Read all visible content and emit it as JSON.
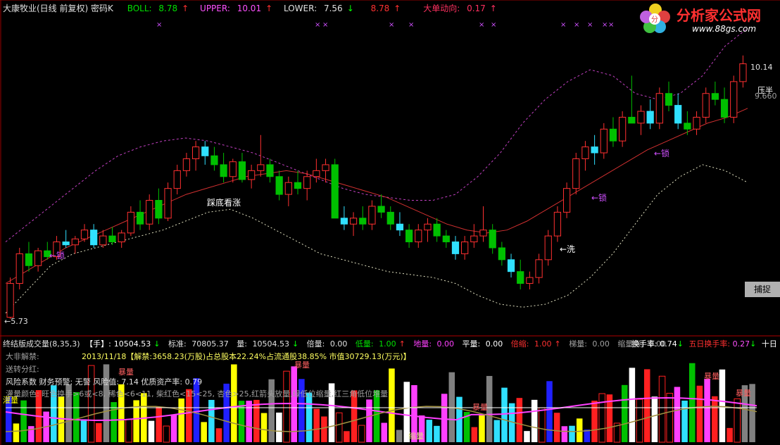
{
  "main_header": {
    "stock_title": "大康牧业(日线 前复权) 密码K",
    "boll_label": "BOLL:",
    "boll_value": "8.78",
    "boll_arrow": "↑",
    "upper_label": "UPPER:",
    "upper_value": "10.01",
    "upper_arrow": "↑",
    "lower_label": "LOWER:",
    "lower_value": "7.56",
    "lower_arrow": "↓",
    "extra_value": "8.78",
    "extra_arrow": "↑",
    "bigorder_label": "大单动向:",
    "bigorder_value": "0.17",
    "bigorder_arrow": "↑"
  },
  "logo": {
    "title": "分析家公式网",
    "url": "www.88gs.com"
  },
  "price_labels": {
    "high": "10.14",
    "mid": "9.660",
    "low": "5.73",
    "low_prefix": "←",
    "right_tag": "压半"
  },
  "annotations": {
    "pattern1": "踩底看涨",
    "lock1": "←锁",
    "lock2": "←锁",
    "lock3": "←锁",
    "wash": "←洗",
    "xmark": "×"
  },
  "capture_button": "捕捉",
  "volume_header": {
    "title": "终结版成交量(8,35,3)",
    "hand_label": "【手】:",
    "hand_value": "10504.53",
    "hand_arrow": "↓",
    "std_label": "标准:",
    "std_value": "70805.37",
    "vol_label": "量:",
    "vol_value": "10504.53",
    "vol_arrow": "↓",
    "bei_label": "倍量:",
    "bei_value": "0.00",
    "low_label": "低量:",
    "low_value": "1.00",
    "low_arrow": "↑",
    "di_label": "地量:",
    "di_value": "0.00",
    "ping_label": "平量:",
    "ping_value": "0.00",
    "beisuo_label": "倍缩:",
    "beisuo_value": "1.00",
    "beisuo_arrow": "↑",
    "ti_label": "梯量:",
    "ti_value": "0.00",
    "suozhang_label": "缩量涨:",
    "suozhang_value": "0.00",
    "turnover_label": "换手率:",
    "turnover_value": "0.74",
    "turnover_arrow": "↓",
    "five_label": "五日换手率:",
    "five_value": "0.27",
    "five_arrow": "↓",
    "ten_label": "十日"
  },
  "info_lines": {
    "unlock_title": "大非解禁:",
    "unlock_text": "2013/11/18【解禁:3658.23(万股)占总股本22.24%占流通股38.85% 市值30729.13(万元)】",
    "dividend": "送转分红:",
    "risk": "风险系数 财务预警: 无警   风险值: 7.14   优质资产率: 0.79",
    "note": "灌量颜色: 旺色换手>6或<8, 稀色<6<11, 柴红色<15<25, 杏色>25,红箭头放量,绿低位缩量,红三角低位堆量"
  },
  "volume_marks": {
    "burst": "暴量",
    "shrink": "缩量",
    "fill": "灌量"
  },
  "chart_data": {
    "type": "candlestick",
    "price_range": [
      5.5,
      10.6
    ],
    "candles": [
      [
        5.73,
        6.4,
        5.7,
        6.3
      ],
      [
        6.3,
        6.9,
        6.2,
        6.8
      ],
      [
        6.8,
        7.0,
        6.5,
        6.6
      ],
      [
        6.6,
        6.9,
        6.5,
        6.85
      ],
      [
        6.85,
        7.0,
        6.7,
        6.75
      ],
      [
        6.75,
        7.1,
        6.7,
        7.0
      ],
      [
        7.0,
        7.2,
        6.9,
        6.95
      ],
      [
        6.95,
        7.1,
        6.8,
        7.05
      ],
      [
        7.05,
        7.3,
        7.0,
        7.2
      ],
      [
        7.2,
        7.3,
        6.9,
        6.95
      ],
      [
        6.95,
        7.2,
        6.9,
        7.1
      ],
      [
        7.1,
        7.25,
        6.95,
        7.0
      ],
      [
        7.0,
        7.2,
        6.9,
        7.15
      ],
      [
        7.15,
        7.6,
        7.1,
        7.5
      ],
      [
        7.5,
        7.7,
        7.2,
        7.3
      ],
      [
        7.3,
        7.8,
        7.2,
        7.7
      ],
      [
        7.7,
        7.9,
        7.3,
        7.4
      ],
      [
        7.4,
        8.0,
        7.35,
        7.9
      ],
      [
        7.9,
        8.3,
        7.8,
        8.2
      ],
      [
        8.2,
        8.5,
        8.1,
        8.4
      ],
      [
        8.4,
        8.7,
        8.2,
        8.6
      ],
      [
        8.6,
        8.7,
        8.3,
        8.45
      ],
      [
        8.45,
        8.6,
        8.2,
        8.3
      ],
      [
        8.3,
        8.5,
        8.0,
        8.1
      ],
      [
        8.1,
        8.4,
        8.0,
        8.35
      ],
      [
        8.35,
        8.5,
        8.0,
        8.05
      ],
      [
        8.05,
        8.3,
        7.9,
        8.2
      ],
      [
        8.2,
        8.8,
        8.1,
        8.3
      ],
      [
        8.3,
        8.4,
        8.0,
        8.1
      ],
      [
        8.1,
        8.2,
        7.7,
        7.8
      ],
      [
        7.8,
        8.1,
        7.6,
        8.0
      ],
      [
        8.0,
        8.2,
        7.8,
        7.9
      ],
      [
        7.9,
        8.2,
        7.7,
        8.1
      ],
      [
        8.1,
        8.4,
        8.0,
        8.2
      ],
      [
        8.2,
        8.4,
        8.0,
        8.3
      ],
      [
        8.3,
        8.4,
        7.6,
        7.4
      ],
      [
        7.4,
        7.6,
        7.2,
        7.3
      ],
      [
        7.3,
        7.5,
        7.1,
        7.4
      ],
      [
        7.4,
        7.6,
        7.2,
        7.3
      ],
      [
        7.3,
        7.7,
        7.2,
        7.6
      ],
      [
        7.6,
        7.8,
        7.4,
        7.5
      ],
      [
        7.5,
        7.6,
        7.2,
        7.3
      ],
      [
        7.3,
        7.5,
        7.1,
        7.2
      ],
      [
        7.2,
        7.3,
        6.9,
        7.0
      ],
      [
        7.0,
        7.3,
        6.9,
        7.2
      ],
      [
        7.2,
        7.4,
        7.0,
        7.3
      ],
      [
        7.3,
        7.4,
        7.0,
        7.1
      ],
      [
        7.1,
        7.2,
        6.9,
        7.0
      ],
      [
        7.0,
        7.1,
        6.7,
        6.8
      ],
      [
        6.8,
        7.1,
        6.7,
        7.0
      ],
      [
        7.0,
        7.3,
        6.9,
        7.1
      ],
      [
        7.1,
        7.6,
        7.0,
        7.2
      ],
      [
        7.2,
        7.3,
        6.8,
        6.9
      ],
      [
        6.9,
        7.0,
        6.6,
        6.7
      ],
      [
        6.7,
        6.8,
        6.4,
        6.5
      ],
      [
        6.5,
        6.7,
        6.2,
        6.3
      ],
      [
        6.3,
        6.5,
        6.2,
        6.4
      ],
      [
        6.4,
        6.8,
        6.3,
        6.7
      ],
      [
        6.7,
        7.2,
        6.6,
        7.1
      ],
      [
        7.1,
        7.6,
        7.0,
        7.5
      ],
      [
        7.5,
        8.0,
        7.4,
        7.9
      ],
      [
        7.9,
        8.5,
        7.8,
        8.4
      ],
      [
        8.4,
        8.7,
        8.2,
        8.6
      ],
      [
        8.6,
        8.8,
        8.3,
        8.5
      ],
      [
        8.5,
        9.0,
        8.4,
        8.9
      ],
      [
        8.9,
        9.1,
        8.6,
        8.7
      ],
      [
        8.7,
        9.2,
        8.6,
        9.1
      ],
      [
        9.1,
        9.8,
        9.0,
        9.0
      ],
      [
        9.0,
        9.3,
        8.8,
        9.2
      ],
      [
        9.2,
        9.4,
        8.9,
        9.0
      ],
      [
        9.0,
        9.6,
        8.9,
        9.5
      ],
      [
        9.5,
        9.7,
        9.2,
        9.3
      ],
      [
        9.3,
        9.5,
        8.9,
        9.0
      ],
      [
        9.0,
        9.2,
        8.8,
        8.9
      ],
      [
        8.9,
        9.2,
        8.8,
        9.1
      ],
      [
        9.1,
        9.6,
        9.0,
        9.5
      ],
      [
        9.5,
        9.7,
        9.3,
        9.4
      ],
      [
        9.4,
        9.6,
        9.0,
        9.1
      ],
      [
        9.1,
        9.8,
        9.0,
        9.7
      ],
      [
        9.7,
        10.14,
        9.6,
        10.0
      ]
    ],
    "mid_line": [
      6.3,
      6.5,
      6.7,
      6.9,
      7.05,
      7.2,
      7.35,
      7.5,
      7.65,
      7.8,
      7.9,
      8.0,
      8.1,
      8.15,
      8.2,
      8.15,
      8.05,
      7.95,
      7.85,
      7.75,
      7.6,
      7.45,
      7.3,
      7.2,
      7.15,
      7.2,
      7.35,
      7.55,
      7.75,
      7.95,
      8.15,
      8.35,
      8.55,
      8.7,
      8.85,
      9.0,
      9.1,
      9.25
    ],
    "upper_line": [
      7.0,
      7.3,
      7.6,
      7.9,
      8.2,
      8.45,
      8.6,
      8.7,
      8.75,
      8.7,
      8.6,
      8.5,
      8.35,
      8.2,
      8.05,
      7.9,
      7.8,
      7.75,
      7.7,
      7.7,
      7.8,
      8.1,
      8.5,
      9.0,
      9.4,
      9.7,
      9.9,
      9.8,
      9.5,
      9.4,
      9.5,
      9.8,
      10.3,
      10.6
    ],
    "lower_line": [
      5.8,
      6.2,
      6.6,
      6.8,
      6.9,
      7.0,
      7.1,
      7.2,
      7.35,
      7.5,
      7.55,
      7.4,
      7.2,
      7.0,
      6.8,
      6.7,
      6.6,
      6.5,
      6.45,
      6.4,
      6.3,
      6.1,
      5.95,
      5.9,
      5.95,
      6.1,
      6.4,
      6.8,
      7.3,
      7.8,
      8.1,
      8.3,
      8.2,
      8.0
    ]
  }
}
